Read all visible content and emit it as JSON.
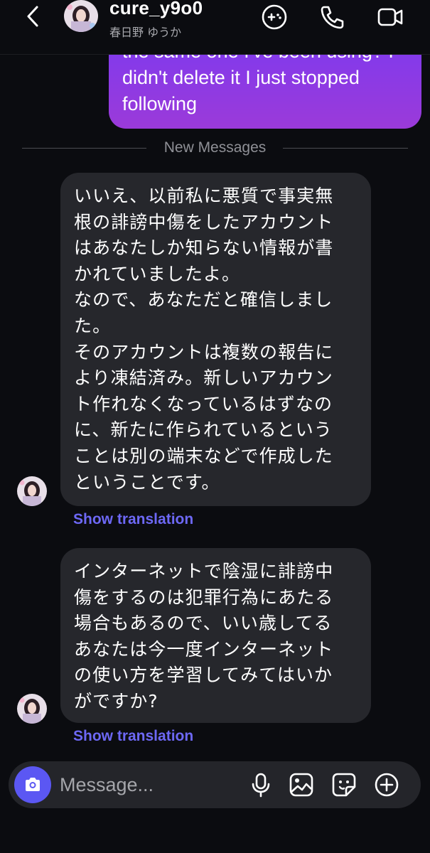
{
  "header": {
    "username": "cure_y9o0",
    "display_name": "春日野 ゆうか"
  },
  "sent_message": {
    "text": "the same one I've been using? I didn't delete it I just stopped following"
  },
  "divider": {
    "label": "New Messages"
  },
  "messages": [
    {
      "text": "いいえ、以前私に悪質で事実無\n根の誹謗中傷をしたアカウント\nはあなたしか知らない情報が書\nかれていましたよ。\nなので、あなただと確信しまし\nた。\nそのアカウントは複数の報告に\nより凍結済み。新しいアカウン\nト作れなくなっているはずなの\nに、新たに作られているという\nことは別の端末などで作成した\nということです。",
      "action_label": "Show translation"
    },
    {
      "text": "インターネットで陰湿に誹謗中\n傷をするのは犯罪行為にあたる\n場合もあるので、いい歳してる\nあなたは今一度インターネット\nの使い方を学習してみてはいか\nがですか?",
      "action_label": "Show translation"
    }
  ],
  "composer": {
    "placeholder": "Message..."
  },
  "icons": {
    "back": "chevron-left-icon",
    "games": "gamepad-icon",
    "call": "phone-icon",
    "video": "video-camera-icon",
    "camera": "camera-icon",
    "mic": "microphone-icon",
    "gallery": "image-icon",
    "sticker": "sticker-icon",
    "add": "plus-circle-icon"
  },
  "colors": {
    "background": "#0b0c10",
    "sent_bubble": "#8a3ae6",
    "received_bubble": "#26272c",
    "accent": "#6d68f5",
    "camera_button": "#5b57f3"
  }
}
